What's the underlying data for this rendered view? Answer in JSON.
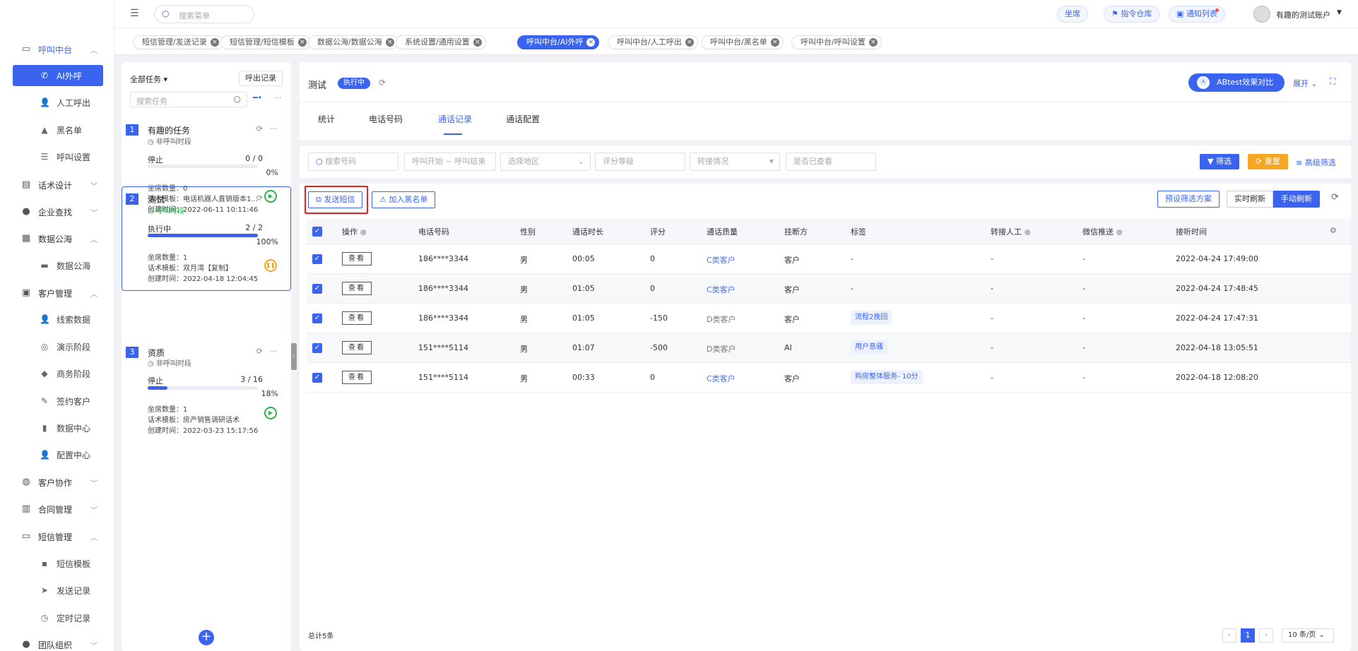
{
  "sidebar": {
    "groups": [
      {
        "label": "呼叫中台",
        "icon": "monitor-icon",
        "open": true
      },
      {
        "label": "话术设计",
        "icon": "script-icon"
      },
      {
        "label": "企业查找",
        "icon": "bulb-icon"
      },
      {
        "label": "数据公海",
        "icon": "chart-icon",
        "open": true
      },
      {
        "label": "客户管理",
        "icon": "customer-icon",
        "open": true
      },
      {
        "label": "客户协作",
        "icon": "collab-icon"
      },
      {
        "label": "合同管理",
        "icon": "contract-icon"
      },
      {
        "label": "短信管理",
        "icon": "sms-icon",
        "open": true
      },
      {
        "label": "团队组织",
        "icon": "team-icon"
      }
    ],
    "items": [
      {
        "label": "AI外呼",
        "icon": "phone-icon",
        "active": true
      },
      {
        "label": "人工呼出",
        "icon": "user-icon"
      },
      {
        "label": "黑名单",
        "icon": "warning-icon"
      },
      {
        "label": "呼叫设置",
        "icon": "sliders-icon"
      },
      {
        "label": "数据公海",
        "icon": "table-icon"
      },
      {
        "label": "线索数据",
        "icon": "user-icon"
      },
      {
        "label": "演示阶段",
        "icon": "circle-icon"
      },
      {
        "label": "商务阶段",
        "icon": "diamond-icon"
      },
      {
        "label": "签约客户",
        "icon": "edit-icon"
      },
      {
        "label": "数据中心",
        "icon": "bar-icon"
      },
      {
        "label": "配置中心",
        "icon": "user-icon"
      },
      {
        "label": "短信模板",
        "icon": "chat-icon"
      },
      {
        "label": "发送记录",
        "icon": "send-icon"
      },
      {
        "label": "定时记录",
        "icon": "clock-icon"
      }
    ]
  },
  "header": {
    "search_placeholder": "搜索菜单",
    "btn_seat": "坐席",
    "btn_cmd": "指令仓库",
    "btn_notify": "通知列表",
    "account": "有趣的测试账户"
  },
  "page_tabs": [
    {
      "label": "短信管理/发送记录"
    },
    {
      "label": "短信管理/短信模板"
    },
    {
      "label": "数据公海/数据公海"
    },
    {
      "label": "系统设置/通用设置"
    },
    {
      "label": "呼叫中台/AI外呼",
      "active": true
    },
    {
      "label": "呼叫中台/人工呼出"
    },
    {
      "label": "呼叫中台/黑名单"
    },
    {
      "label": "呼叫中台/呼叫设置"
    }
  ],
  "tasks_panel": {
    "filter_label": "全部任务",
    "call_record_btn": "呼出记录",
    "search_placeholder": "搜索任务",
    "tasks": [
      {
        "num": "1",
        "title": "有趣的任务",
        "period": "非呼叫时段",
        "status": "停止",
        "count": "0 / 0",
        "progress": 0,
        "pct": "0%",
        "seats": "坐席数量：0",
        "template": "话术模板：电话机器人直销版本1...",
        "created": "创建时间：2022-06-11 10:11:46"
      },
      {
        "num": "2",
        "title": "测试",
        "period": "呼叫时段",
        "status": "执行中",
        "count": "2 / 2",
        "progress": 100,
        "pct": "100%",
        "seats": "坐席数量：1",
        "template": "话术模板：双月湾【复制】",
        "created": "创建时间：2022-04-18 12:04:45"
      },
      {
        "num": "3",
        "title": "资质",
        "period": "非呼叫时段",
        "status": "停止",
        "count": "3 / 16",
        "progress": 18,
        "pct": "18%",
        "seats": "坐席数量：1",
        "template": "话术模板：房产销售调研话术",
        "created": "创建时间：2022-03-23 15:17:56"
      }
    ]
  },
  "main": {
    "task_title": "测试",
    "status_badge": "执行中",
    "ab_btn": "ABtest效果对比",
    "expand": "展开",
    "subtabs": [
      "统计",
      "电话号码",
      "通话记录",
      "通话配置"
    ],
    "active_subtab": 2,
    "filters": {
      "phone": "搜索号码",
      "time": "呼叫开始 ~ 呼叫结束",
      "region": "选择地区",
      "grade": "评分等级",
      "transfer": "转接情况",
      "viewed": "是否已查看"
    },
    "filter_btn": "筛选",
    "reset_btn": "重置",
    "advanced_btn": "高级筛选",
    "send_sms_btn": "发送短信",
    "blacklist_btn": "加入黑名单",
    "preset_btn": "预设筛选方案",
    "realtime_btn": "实时刷新",
    "manual_btn": "手动刷新",
    "columns": [
      "操作",
      "电话号码",
      "性别",
      "通话时长",
      "评分",
      "通话质量",
      "挂断方",
      "标签",
      "转接人工",
      "微信推送",
      "接听时间"
    ],
    "view_label": "查看",
    "rows": [
      {
        "phone": "186****3344",
        "gender": "男",
        "duration": "00:05",
        "score": "0",
        "quality": "C类客户",
        "qd": false,
        "hangup": "客户",
        "tag": "-",
        "transfer": "-",
        "wechat": "-",
        "time": "2022-04-24 17:49:00"
      },
      {
        "phone": "186****3344",
        "gender": "男",
        "duration": "01:05",
        "score": "0",
        "quality": "C类客户",
        "qd": false,
        "hangup": "客户",
        "tag": "-",
        "transfer": "-",
        "wechat": "-",
        "time": "2022-04-24 17:48:45"
      },
      {
        "phone": "186****3344",
        "gender": "男",
        "duration": "01:05",
        "score": "-150",
        "quality": "D类客户",
        "qd": true,
        "hangup": "客户",
        "tag": "流程2挽回",
        "transfer": "-",
        "wechat": "-",
        "time": "2022-04-24 17:47:31"
      },
      {
        "phone": "151****5114",
        "gender": "男",
        "duration": "01:07",
        "score": "-500",
        "quality": "D类客户",
        "qd": true,
        "hangup": "AI",
        "tag": "用户息骚",
        "transfer": "-",
        "wechat": "-",
        "time": "2022-04-18 13:05:51"
      },
      {
        "phone": "151****5114",
        "gender": "男",
        "duration": "00:33",
        "score": "0",
        "quality": "C类客户",
        "qd": false,
        "hangup": "客户",
        "tag": "购房整体服务- 10分",
        "transfer": "-",
        "wechat": "-",
        "time": "2022-04-18 12:08:20"
      }
    ],
    "total": "总计5条",
    "page": "1",
    "page_size": "10 条/页"
  }
}
